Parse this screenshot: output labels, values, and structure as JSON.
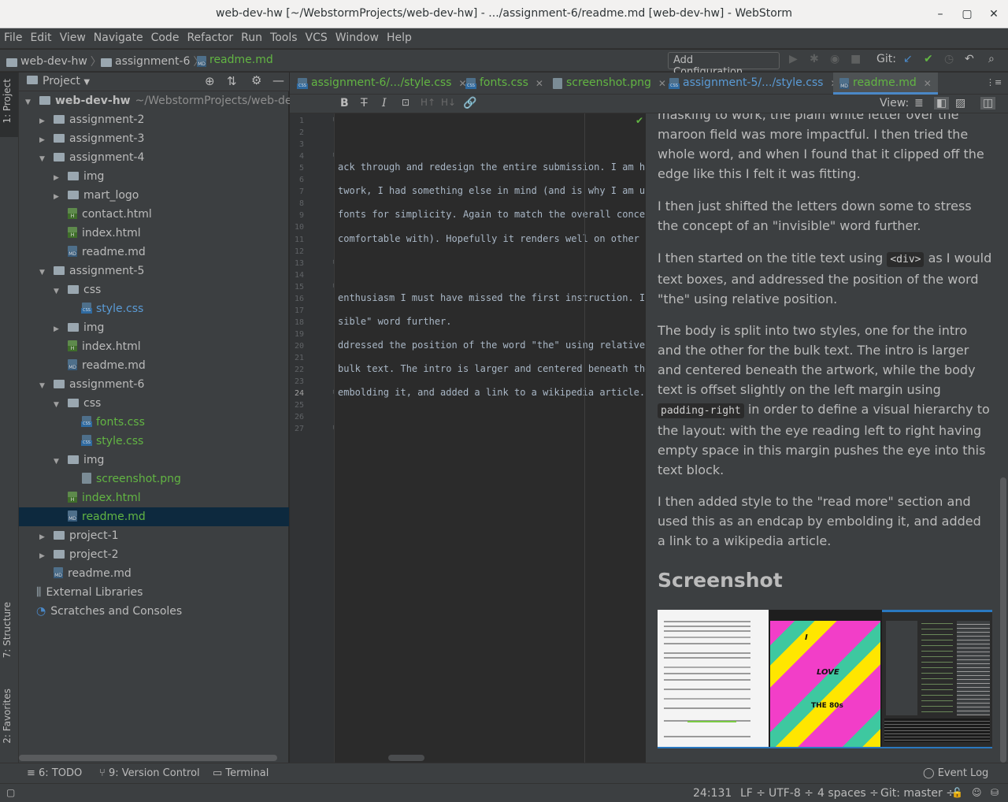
{
  "window": {
    "title": "web-dev-hw [~/WebstormProjects/web-dev-hw] - .../assignment-6/readme.md [web-dev-hw] - WebStorm"
  },
  "menu": [
    "File",
    "Edit",
    "View",
    "Navigate",
    "Code",
    "Refactor",
    "Run",
    "Tools",
    "VCS",
    "Window",
    "Help"
  ],
  "breadcrumb": {
    "root": "web-dev-hw",
    "folder": "assignment-6",
    "file": "readme.md"
  },
  "toolbar": {
    "add_configuration": "Add Configuration...",
    "git_label": "Git:"
  },
  "left_strip": {
    "project": "1: Project",
    "structure": "7: Structure",
    "favorites": "2: Favorites"
  },
  "project_panel": {
    "title": "Project",
    "tree": [
      {
        "name": "web-dev-hw",
        "extra": "~/WebstormProjects/web-dev-h",
        "type": "folder",
        "depth": 0,
        "expanded": true
      },
      {
        "name": "assignment-2",
        "type": "folder",
        "depth": 1,
        "expanded": false
      },
      {
        "name": "assignment-3",
        "type": "folder",
        "depth": 1,
        "expanded": false
      },
      {
        "name": "assignment-4",
        "type": "folder",
        "depth": 1,
        "expanded": true
      },
      {
        "name": "img",
        "type": "folder",
        "depth": 2,
        "expanded": false
      },
      {
        "name": "mart_logo",
        "type": "folder",
        "depth": 2,
        "expanded": false
      },
      {
        "name": "contact.html",
        "type": "html",
        "depth": 2
      },
      {
        "name": "index.html",
        "type": "html",
        "depth": 2
      },
      {
        "name": "readme.md",
        "type": "md",
        "depth": 2
      },
      {
        "name": "assignment-5",
        "type": "folder",
        "depth": 1,
        "expanded": true
      },
      {
        "name": "css",
        "type": "folder",
        "depth": 2,
        "expanded": true
      },
      {
        "name": "style.css",
        "type": "css",
        "depth": 3,
        "color": "blue"
      },
      {
        "name": "img",
        "type": "folder",
        "depth": 2,
        "expanded": false
      },
      {
        "name": "index.html",
        "type": "html",
        "depth": 2
      },
      {
        "name": "readme.md",
        "type": "md",
        "depth": 2
      },
      {
        "name": "assignment-6",
        "type": "folder",
        "depth": 1,
        "expanded": true
      },
      {
        "name": "css",
        "type": "folder",
        "depth": 2,
        "expanded": true
      },
      {
        "name": "fonts.css",
        "type": "css",
        "depth": 3,
        "color": "green"
      },
      {
        "name": "style.css",
        "type": "css",
        "depth": 3,
        "color": "green"
      },
      {
        "name": "img",
        "type": "folder",
        "depth": 2,
        "expanded": true
      },
      {
        "name": "screenshot.png",
        "type": "png",
        "depth": 3,
        "color": "green"
      },
      {
        "name": "index.html",
        "type": "html",
        "depth": 2,
        "color": "green"
      },
      {
        "name": "readme.md",
        "type": "md",
        "depth": 2,
        "color": "green",
        "selected": true
      },
      {
        "name": "project-1",
        "type": "folder",
        "depth": 1,
        "expanded": false
      },
      {
        "name": "project-2",
        "type": "folder",
        "depth": 1,
        "expanded": false
      },
      {
        "name": "readme.md",
        "type": "md",
        "depth": 1
      },
      {
        "name": "External Libraries",
        "type": "lib",
        "depth": 0
      },
      {
        "name": "Scratches and Consoles",
        "type": "scratch",
        "depth": 0
      }
    ]
  },
  "tabs": [
    {
      "label": "assignment-6/.../style.css",
      "color": "green"
    },
    {
      "label": "fonts.css",
      "color": "green"
    },
    {
      "label": "screenshot.png",
      "color": "green"
    },
    {
      "label": "assignment-5/.../style.css",
      "color": "blue"
    },
    {
      "label": "readme.md",
      "color": "green",
      "active": true
    }
  ],
  "md_toolbar": {
    "view_label": "View:"
  },
  "editor": {
    "line_numbers": [
      "1",
      "2",
      "3",
      "4",
      "5",
      "6",
      "7",
      "8",
      "9",
      "10",
      "11",
      "12",
      "13",
      "14",
      "15",
      "16",
      "17",
      "18",
      "19",
      "20",
      "21",
      "22",
      "23",
      "24",
      "25",
      "26",
      "27"
    ],
    "active_line": "24",
    "lines": [
      {
        "n": 5,
        "text": "ack through and redesign the entire submission. I am hap"
      },
      {
        "n": 7,
        "text": "twork, I had something else in mind (and is why I am usi"
      },
      {
        "n": 9,
        "text": "fonts for simplicity. Again to match the overall concept"
      },
      {
        "n": 11,
        "text": "comfortable with). Hopefully it renders well on other sy"
      },
      {
        "n": 16,
        "text": "enthusiasm I must have missed the first instruction. Ini"
      },
      {
        "n": 18,
        "text": "sible\" word further."
      },
      {
        "n": 20,
        "text": "ddressed the position of the word \"the\" using relative p"
      },
      {
        "n": 22,
        "text": "bulk text. The intro is larger and centered beneath the "
      },
      {
        "n": 24,
        "text": " embolding it, and added a link to a wikipedia article."
      }
    ]
  },
  "preview": {
    "p0": "masking to work, the plain white letter over the maroon field was more impactful. I then tried the whole word, and when I found that it clipped off the edge like this I felt it was fitting.",
    "p1": "I then just shifted the letters down some to stress the concept of an \"invisible\" word further.",
    "p2a": "I then started on the title text using ",
    "p2code": "<div>",
    "p2b": " as I would text boxes, and addressed the position of the word \"the\" using relative position.",
    "p3a": "The body is split into two styles, one for the intro and the other for the bulk text. The intro is larger and centered beneath the artwork, while the body text is offset slightly on the left margin using ",
    "p3code": "padding-right",
    "p3b": " in order to define a visual hierarchy to the layout: with the eye reading left to right having empty space in this margin pushes the eye into this text block.",
    "p4": "I then added style to the \"read more\" section and used this as an endcap by embolding it, and added a link to a wikipedia article.",
    "heading": "Screenshot",
    "screenshot_words": [
      "I",
      "LOVE",
      "THE 80s"
    ]
  },
  "bottom_tools": {
    "todo": "6: TODO",
    "vcs": "9: Version Control",
    "terminal": "Terminal",
    "event_log": "Event Log"
  },
  "status": {
    "position": "24:131",
    "line_sep": "LF ÷",
    "encoding": "UTF-8 ÷",
    "indent": "4 spaces ÷",
    "git": "Git: master ÷"
  }
}
